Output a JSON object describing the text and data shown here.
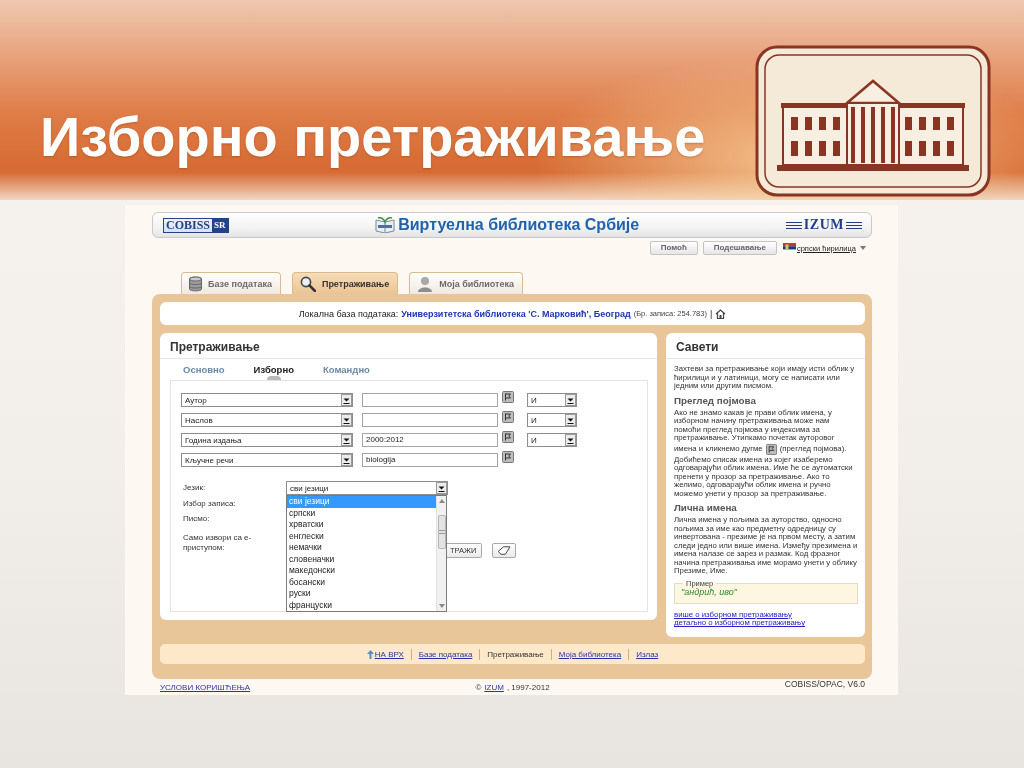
{
  "slide": {
    "title": "Изборно претраживање"
  },
  "header": {
    "logo_left": {
      "name": "COBISS",
      "suffix": "SR"
    },
    "site_title": "Виртуелна библиотека Србије",
    "logo_right": "IZUM"
  },
  "utility": {
    "buttons": [
      "Помоћ",
      "Подешавање"
    ],
    "language": "српски ћирилица"
  },
  "tabs": [
    {
      "label": "Базе података",
      "selected": false
    },
    {
      "label": "Претраживање",
      "selected": true
    },
    {
      "label": "Моја библиотека",
      "selected": false
    }
  ],
  "database_bar": {
    "label": "Локална база података:",
    "name": "Универзитетска библиотека 'С. Марковић', Београд",
    "count": "(Бр. записа: 254.783)",
    "separator": "|"
  },
  "search_panel": {
    "title": "Претраживање",
    "modes": [
      {
        "label": "Основно",
        "selected": false
      },
      {
        "label": "Изборно",
        "selected": true
      },
      {
        "label": "Командно",
        "selected": false
      }
    ],
    "rows": [
      {
        "field": "Аутор",
        "operator": "И"
      },
      {
        "field": "Наслов",
        "operator": "И"
      },
      {
        "field": "Година издања",
        "value": "2000:2012",
        "operator": "И"
      },
      {
        "field": "Кључне речи",
        "value": "biologija"
      }
    ],
    "filters": [
      {
        "label": "Језик:"
      },
      {
        "label": "Избор записа:"
      },
      {
        "label": "Писмо:"
      },
      {
        "label": "Само извори са е-приступом:"
      }
    ],
    "search_button": "ТРАЖИ"
  },
  "language_select": {
    "value": "сви језици",
    "expanded": true,
    "options": [
      {
        "label": "сви језици",
        "selected": true
      },
      {
        "label": "српски",
        "selected": false
      },
      {
        "label": "хрватски",
        "selected": false
      },
      {
        "label": "енглески",
        "selected": false
      },
      {
        "label": "немачки",
        "selected": false
      },
      {
        "label": "словеначки",
        "selected": false
      },
      {
        "label": "македонски",
        "selected": false
      },
      {
        "label": "босански",
        "selected": false
      },
      {
        "label": "руски",
        "selected": false
      },
      {
        "label": "француски",
        "selected": false
      }
    ]
  },
  "tips": {
    "title": "Савети",
    "intro": "Захтеви за претраживање који имају исти облик у ћирилици и у латиници, могу се написати или једним или другим писмом.",
    "sections": [
      {
        "heading": "Преглед појмова",
        "text": "Ако не знамо какав је прави облик имена, у изборном начину претраживања може нам помоћи преглед појмова у индексима за претраживање. Утипкамо почетак ауторовог",
        "button_line": {
          "before": "имена и кликнемо дугме",
          "after": "(преглед појмова)."
        },
        "text_after": "Добићемо списак имена из којег изаберемо одговарајући облик имена. Име ће се аутоматски пренети у прозор за претраживање. Ако то желимо, одговарајући облик имена и ручно можемо унети у прозор за претраживање."
      },
      {
        "heading": "Лична имена",
        "text": "Лична имена у пољима за ауторство, односно пољима за име као предметну одредницу су инвертована - презиме је на првом месту, а затим следи једно или више имена. Између презимена и имена налазе се зарез и размак. Код фразног начина претраживања име морамо унети у облику Презиме, Име."
      }
    ],
    "example": {
      "legend": "Пример",
      "text": "\"андрић, иво\""
    },
    "links": [
      "више о изборном претраживању",
      "детаљно о изборном претраживању"
    ]
  },
  "footer": {
    "links": [
      {
        "label": "НА ВРХ",
        "selected": false
      },
      {
        "label": "Базе података",
        "selected": false
      },
      {
        "label": "Претраживање",
        "selected": true
      },
      {
        "label": "Моја библиотека",
        "selected": false
      },
      {
        "label": "Излаз",
        "selected": false
      }
    ]
  },
  "bottom": {
    "terms": "УСЛОВИ КОРИШЋЕЊА",
    "copyright": {
      "symbol": "©",
      "owner": "IZUM",
      "years": ", 1997-2012"
    },
    "version": "COBISS/OPAC, V6.0"
  }
}
